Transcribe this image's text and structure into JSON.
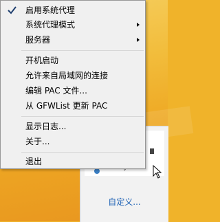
{
  "menu": {
    "items": [
      {
        "label": "启用系统代理",
        "checked": true
      },
      {
        "label": "系统代理模式",
        "submenu": true
      },
      {
        "label": "服务器",
        "submenu": true
      },
      {
        "label": "开机启动"
      },
      {
        "label": "允许来自局域网的连接"
      },
      {
        "label": "编辑 PAC 文件..."
      },
      {
        "label": "从 GFWList 更新 PAC"
      },
      {
        "label": "显示日志..."
      },
      {
        "label": "关于..."
      },
      {
        "label": "退出"
      }
    ]
  },
  "tray": {
    "customize_link": "自定义..."
  },
  "icons": [
    "checkmark-icon",
    "submenu-arrow-icon",
    "mouse-cursor-icon"
  ]
}
